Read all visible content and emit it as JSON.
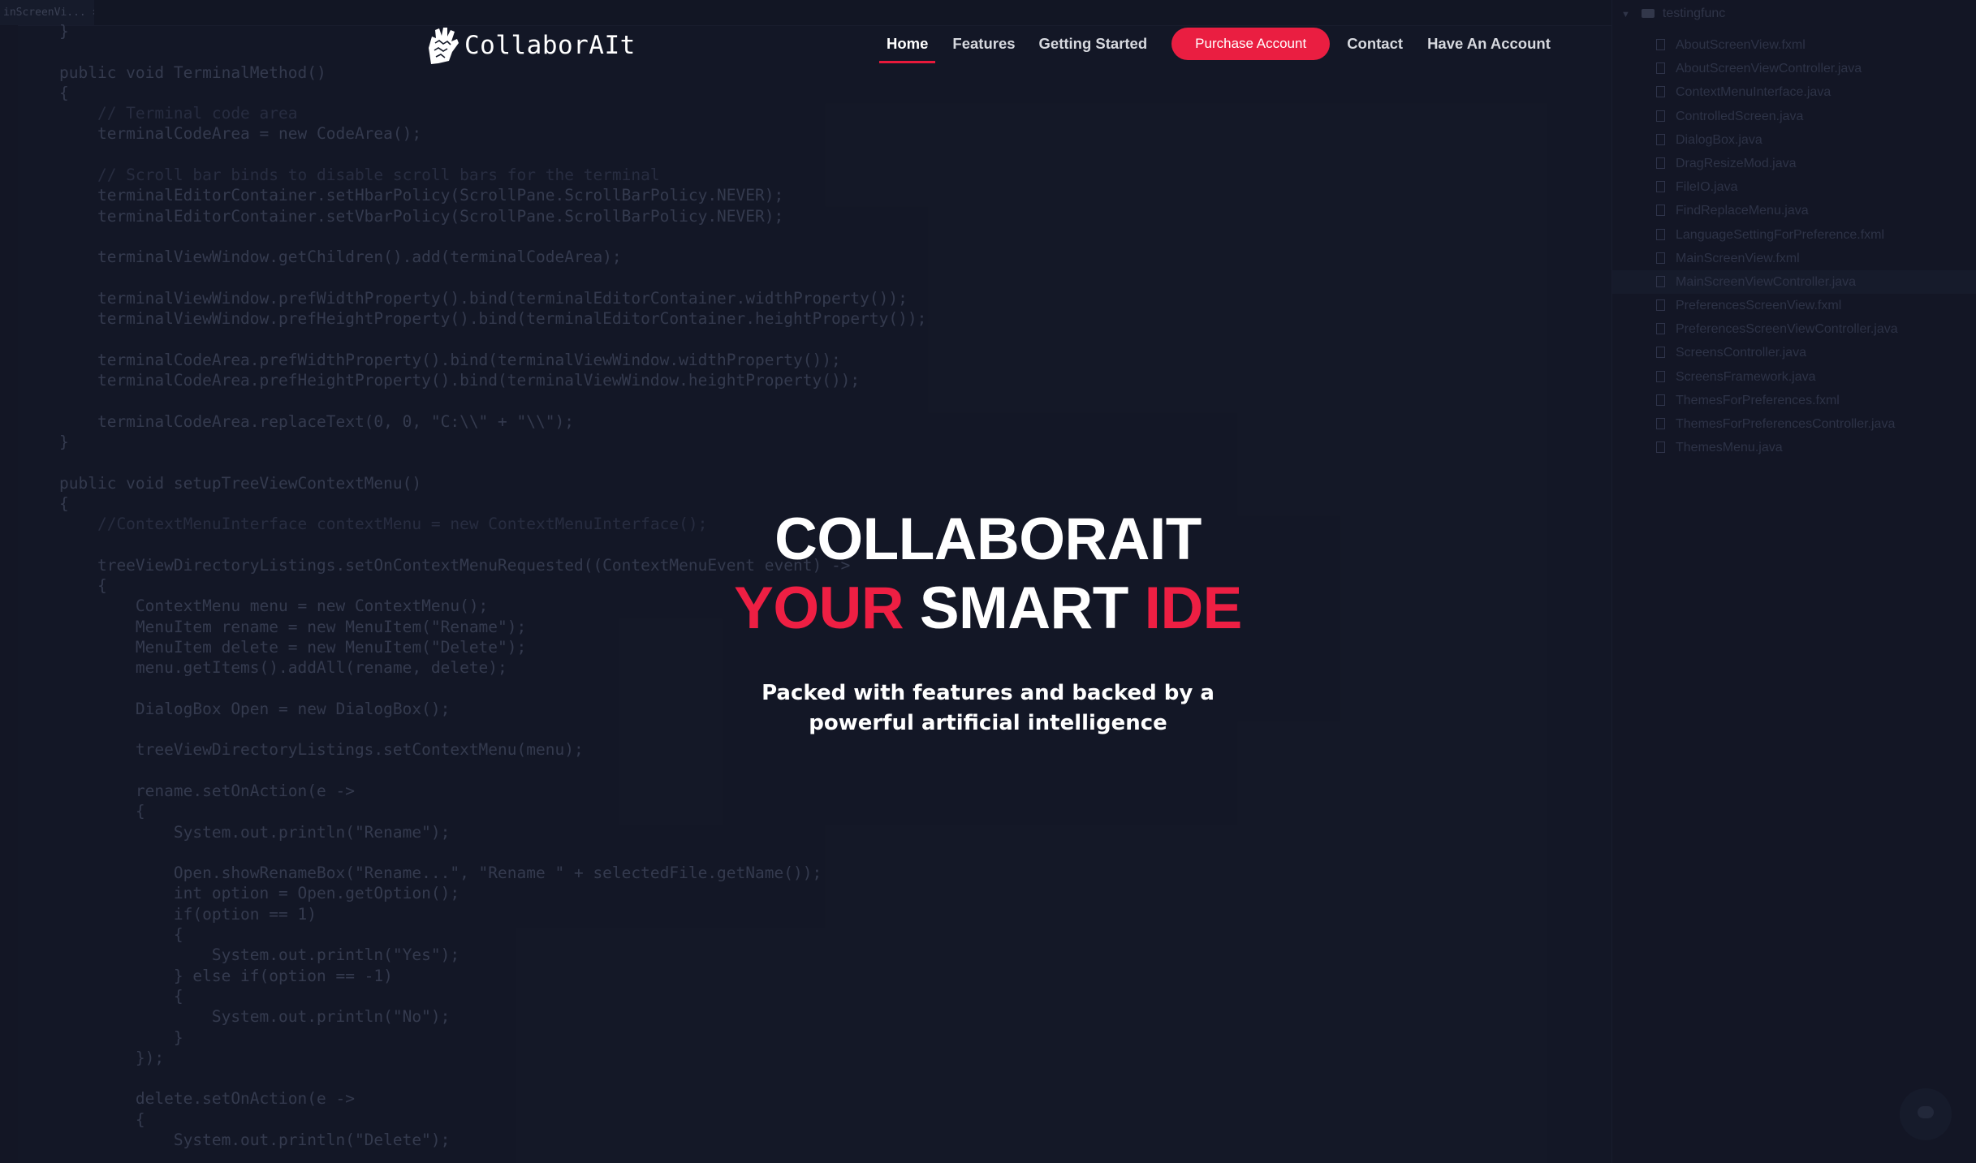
{
  "ide": {
    "tab_label": "inScreenVi... ×",
    "code_lines": [
      "}",
      "",
      "public void TerminalMethod()",
      "{",
      "    // Terminal code area",
      "    terminalCodeArea = new CodeArea();",
      "",
      "    // Scroll bar binds to disable scroll bars for the terminal",
      "    terminalEditorContainer.setHbarPolicy(ScrollPane.ScrollBarPolicy.NEVER);",
      "    terminalEditorContainer.setVbarPolicy(ScrollPane.ScrollBarPolicy.NEVER);",
      "",
      "    terminalViewWindow.getChildren().add(terminalCodeArea);",
      "",
      "    terminalViewWindow.prefWidthProperty().bind(terminalEditorContainer.widthProperty());",
      "    terminalViewWindow.prefHeightProperty().bind(terminalEditorContainer.heightProperty());",
      "",
      "    terminalCodeArea.prefWidthProperty().bind(terminalViewWindow.widthProperty());",
      "    terminalCodeArea.prefHeightProperty().bind(terminalViewWindow.heightProperty());",
      "",
      "    terminalCodeArea.replaceText(0, 0, \"C:\\\\\" + \"\\\\\");",
      "}",
      "",
      "public void setupTreeViewContextMenu()",
      "{",
      "    //ContextMenuInterface contextMenu = new ContextMenuInterface();",
      "",
      "    treeViewDirectoryListings.setOnContextMenuRequested((ContextMenuEvent event) ->",
      "    {",
      "        ContextMenu menu = new ContextMenu();",
      "        MenuItem rename = new MenuItem(\"Rename\");",
      "        MenuItem delete = new MenuItem(\"Delete\");",
      "        menu.getItems().addAll(rename, delete);",
      "",
      "        DialogBox Open = new DialogBox();",
      "",
      "        treeViewDirectoryListings.setContextMenu(menu);",
      "",
      "        rename.setOnAction(e ->",
      "        {",
      "            System.out.println(\"Rename\");",
      "",
      "            Open.showRenameBox(\"Rename...\", \"Rename \" + selectedFile.getName());",
      "            int option = Open.getOption();",
      "            if(option == 1)",
      "            {",
      "                System.out.println(\"Yes\");",
      "            } else if(option == -1)",
      "            {",
      "                System.out.println(\"No\");",
      "            }",
      "        });",
      "",
      "        delete.setOnAction(e ->",
      "        {",
      "            System.out.println(\"Delete\");"
    ],
    "tree": {
      "root": "testingfunc",
      "selected_index": 10,
      "files": [
        "AboutScreenView.fxml",
        "AboutScreenViewController.java",
        "ContextMenuInterface.java",
        "ControlledScreen.java",
        "DialogBox.java",
        "DragResizeMod.java",
        "FileIO.java",
        "FindReplaceMenu.java",
        "LanguageSettingForPreference.fxml",
        "MainScreenView.fxml",
        "MainScreenViewController.java",
        "PreferencesScreenView.fxml",
        "PreferencesScreenViewController.java",
        "ScreensController.java",
        "ScreensFramework.java",
        "ThemesForPreferences.fxml",
        "ThemesForPreferencesController.java",
        "ThemesMenu.java"
      ]
    }
  },
  "logo": {
    "text": "CollaborAIt",
    "icon": "hand-logo-icon"
  },
  "nav": {
    "home": "Home",
    "features": "Features",
    "getting_started": "Getting Started",
    "purchase": "Purchase Account",
    "contact": "Contact",
    "have_account": "Have An Account"
  },
  "hero": {
    "title": "COLLABORAIT",
    "tag_your": "YOUR",
    "tag_smart": "SMART",
    "tag_ide": "IDE",
    "subtitle": "Packed with features and backed by a powerful artificial intelligence"
  },
  "colors": {
    "accent": "#ee1f43",
    "background": "#151a29",
    "text": "#ffffff"
  },
  "chat": {
    "icon": "chat-bubble-icon"
  }
}
